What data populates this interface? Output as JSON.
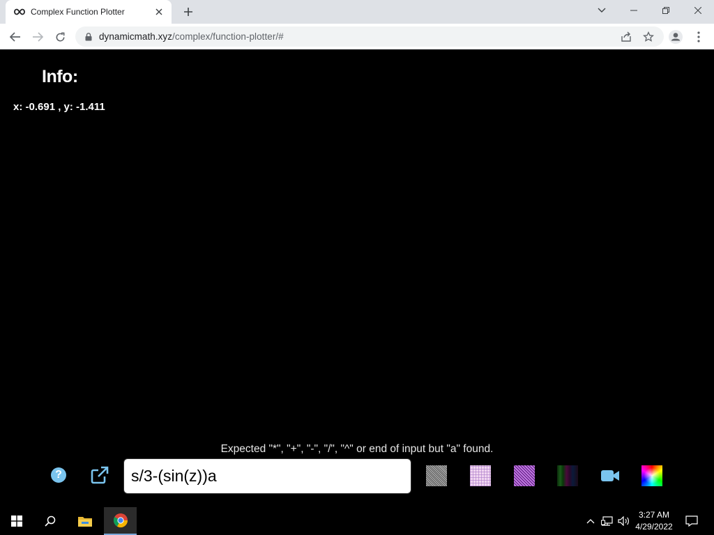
{
  "browser": {
    "tab_title": "Complex Function Plotter",
    "url_host": "dynamicmath.xyz",
    "url_path": "/complex/function-plotter/#"
  },
  "page": {
    "info_title": "Info:",
    "coords_text": "x: -0.691 , y: -1.411",
    "error_message": "Expected \"*\", \"+\", \"-\", \"/\", \"^\" or end of input but \"a\" found.",
    "help_label": "?",
    "expression_value": "s/3-(sin(z))a",
    "accent_color": "#7ac4ee",
    "texture_options": [
      "gray-checker-texture",
      "pink-grid-texture",
      "purple-diamond-texture",
      "dark-stripes-texture"
    ],
    "action_icons": [
      "help-icon",
      "open-external-icon",
      "video-camera-icon",
      "color-wheel-icon"
    ]
  },
  "taskbar": {
    "time": "3:27 AM",
    "date": "4/29/2022",
    "items": [
      "windows-start-icon",
      "search-icon",
      "file-explorer-icon",
      "chrome-icon"
    ],
    "tray": [
      "chevron-up-icon",
      "network-icon",
      "volume-icon",
      "notification-icon"
    ]
  }
}
